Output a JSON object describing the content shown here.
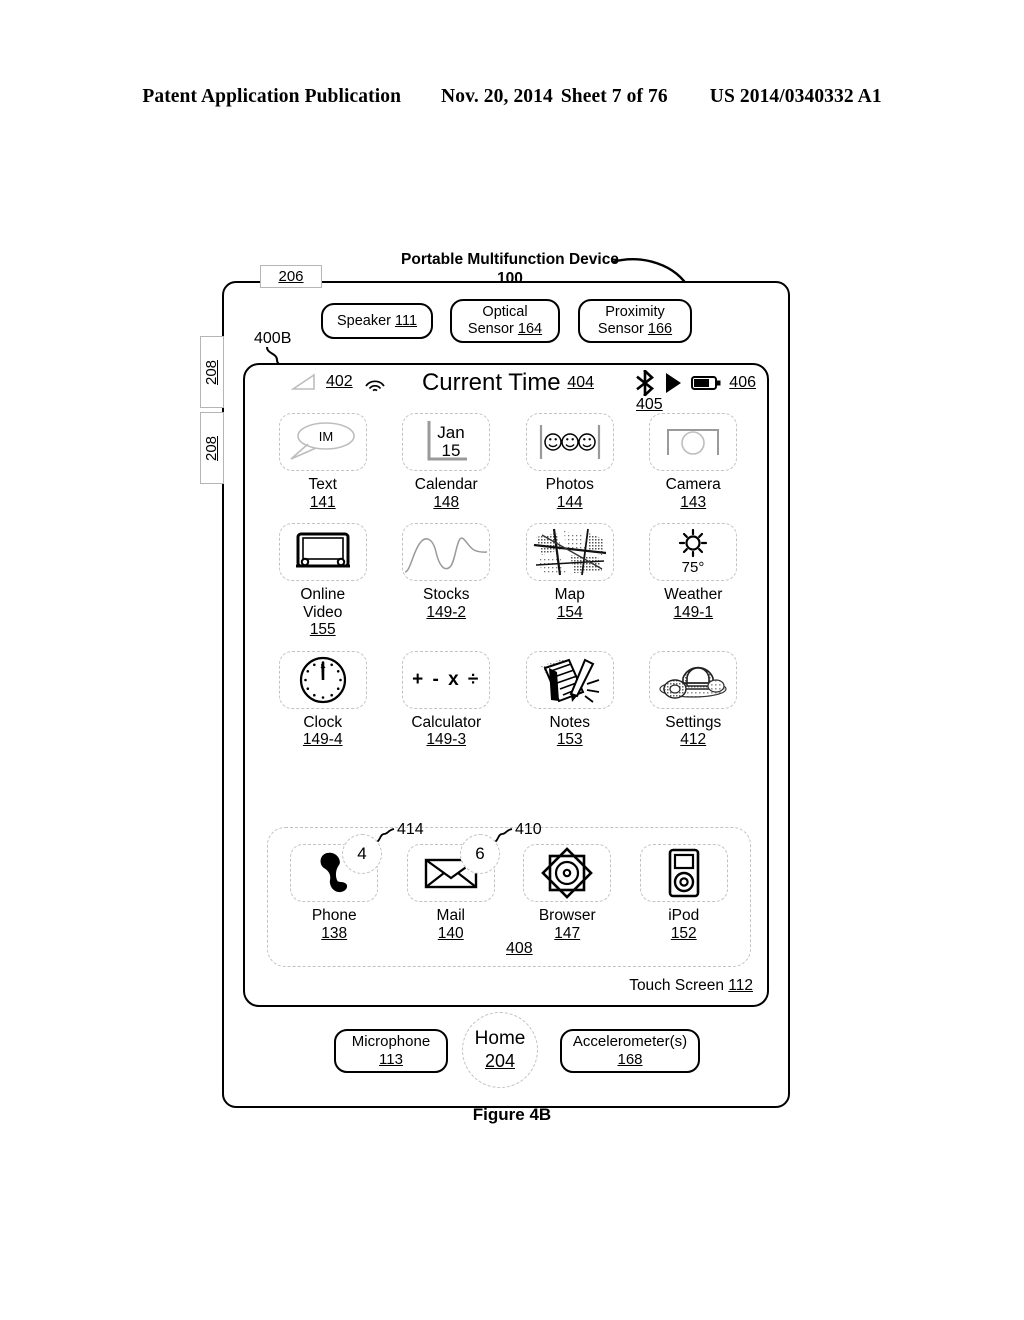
{
  "patent_header": {
    "publication": "Patent Application Publication",
    "date": "Nov. 20, 2014",
    "sheet": "Sheet 7 of 76",
    "number": "US 2014/0340332 A1"
  },
  "figure_caption": "Figure 4B",
  "device": {
    "title": "Portable Multifunction Device",
    "ref": "100",
    "top_tab_ref": "206",
    "side_tab_refs": [
      "208",
      "208"
    ],
    "screen_ref": "400B",
    "sensors": [
      {
        "name": "speaker",
        "label": "Speaker",
        "ref": "111"
      },
      {
        "name": "optical-sensor",
        "label": "Optical",
        "label2": "Sensor",
        "ref": "164"
      },
      {
        "name": "proximity-sensor",
        "label": "Proximity",
        "label2": "Sensor",
        "ref": "166"
      }
    ],
    "bottom_controls": [
      {
        "name": "microphone",
        "label": "Microphone",
        "ref": "113"
      },
      {
        "name": "home-button",
        "label": "Home",
        "ref": "204"
      },
      {
        "name": "accelerometers",
        "label": "Accelerometer(s)",
        "ref": "168"
      }
    ],
    "touch_screen_label": "Touch Screen",
    "touch_screen_ref": "112"
  },
  "status_bar": {
    "signal_icon": "signal-strength-icon",
    "signal_ref": "402",
    "wifi_icon": "wifi-icon",
    "title": "Current Time",
    "title_ref": "404",
    "bluetooth_icon": "bluetooth-icon",
    "bluetooth_ref": "405",
    "play_icon": "play-icon",
    "battery_icon": "battery-icon",
    "battery_ref": "406"
  },
  "apps": {
    "row1": [
      {
        "name": "text",
        "icon": "message-bubble-icon",
        "icon_text": "IM",
        "label": "Text",
        "ref": "141"
      },
      {
        "name": "calendar",
        "icon": "calendar-icon",
        "month": "Jan",
        "day": "15",
        "label": "Calendar",
        "ref": "148"
      },
      {
        "name": "photos",
        "icon": "photos-smiley-icon",
        "label": "Photos",
        "ref": "144"
      },
      {
        "name": "camera",
        "icon": "camera-icon",
        "label": "Camera",
        "ref": "143"
      }
    ],
    "row2": [
      {
        "name": "online-video",
        "icon": "monitor-icon",
        "label": "Online",
        "label2": "Video",
        "ref": "155"
      },
      {
        "name": "stocks",
        "icon": "stock-curve-icon",
        "label": "Stocks",
        "ref": "149-2"
      },
      {
        "name": "map",
        "icon": "map-icon",
        "label": "Map",
        "ref": "154"
      },
      {
        "name": "weather",
        "icon": "sun-icon",
        "temp": "75°",
        "label": "Weather",
        "ref": "149-1"
      }
    ],
    "row3": [
      {
        "name": "clock",
        "icon": "clock-icon",
        "label": "Clock",
        "ref": "149-4"
      },
      {
        "name": "calculator",
        "icon": "calculator-icon",
        "icon_text": "+ - x ÷",
        "label": "Calculator",
        "ref": "149-3"
      },
      {
        "name": "notes",
        "icon": "notepad-pencil-icon",
        "label": "Notes",
        "ref": "153"
      },
      {
        "name": "settings",
        "icon": "gears-icon",
        "label": "Settings",
        "ref": "412"
      }
    ]
  },
  "dock": {
    "ref": "408",
    "items": [
      {
        "name": "phone",
        "icon": "phone-handset-icon",
        "label": "Phone",
        "ref": "138",
        "badge": "4",
        "badge_ref": "414"
      },
      {
        "name": "mail",
        "icon": "envelope-icon",
        "label": "Mail",
        "ref": "140",
        "badge": "6",
        "badge_ref": "410"
      },
      {
        "name": "browser",
        "icon": "compass-star-icon",
        "label": "Browser",
        "ref": "147"
      },
      {
        "name": "ipod",
        "icon": "ipod-icon",
        "label": "iPod",
        "ref": "152"
      }
    ]
  }
}
